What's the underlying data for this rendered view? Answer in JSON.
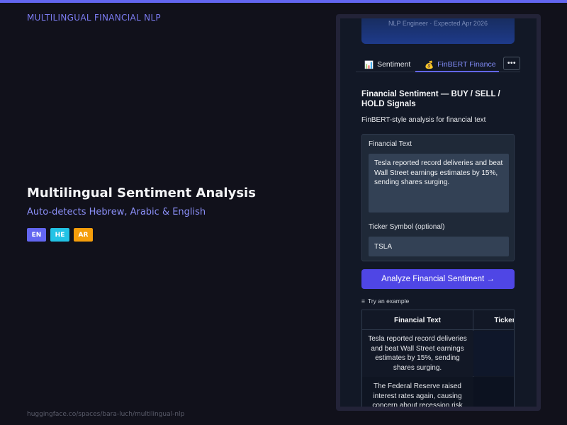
{
  "brand": "MULTILINGUAL FINANCIAL NLP",
  "hero": {
    "title": "Multilingual Sentiment Analysis",
    "subtitle": "Auto-detects Hebrew, Arabic & English",
    "badges": [
      {
        "label": "EN",
        "color": "#6366f1"
      },
      {
        "label": "HE",
        "color": "#22c3e6"
      },
      {
        "label": "AR",
        "color": "#f59e0b"
      }
    ]
  },
  "footer_url": "huggingface.co/spaces/bara-luch/multilingual-nlp",
  "app": {
    "profile_line": "NLP Engineer · Expected Apr 2026",
    "tabs": [
      {
        "icon": "📊",
        "label": "Sentiment",
        "active": false
      },
      {
        "icon": "💰",
        "label": "FinBERT Finance",
        "active": true
      }
    ],
    "more_label": "•••",
    "section_title": "Financial Sentiment — BUY / SELL / HOLD Signals",
    "section_desc": "FinBERT-style analysis for financial text",
    "form": {
      "text_label": "Financial Text",
      "text_value": "Tesla reported record deliveries and beat Wall Street earnings estimates by 15%, sending shares surging.",
      "ticker_label": "Ticker Symbol (optional)",
      "ticker_value": "TSLA"
    },
    "analyze_button": "Analyze Financial Sentiment →",
    "examples": {
      "label": "Try an example",
      "icon": "≡",
      "headers": [
        "Financial Text",
        "Ticker Sy"
      ],
      "rows": [
        {
          "text": "Tesla reported record deliveries and beat Wall Street earnings estimates by 15%, sending shares surging.",
          "ticker": ""
        },
        {
          "text": "The Federal Reserve raised interest rates again, causing concern about recession risk",
          "ticker": ""
        }
      ]
    }
  }
}
